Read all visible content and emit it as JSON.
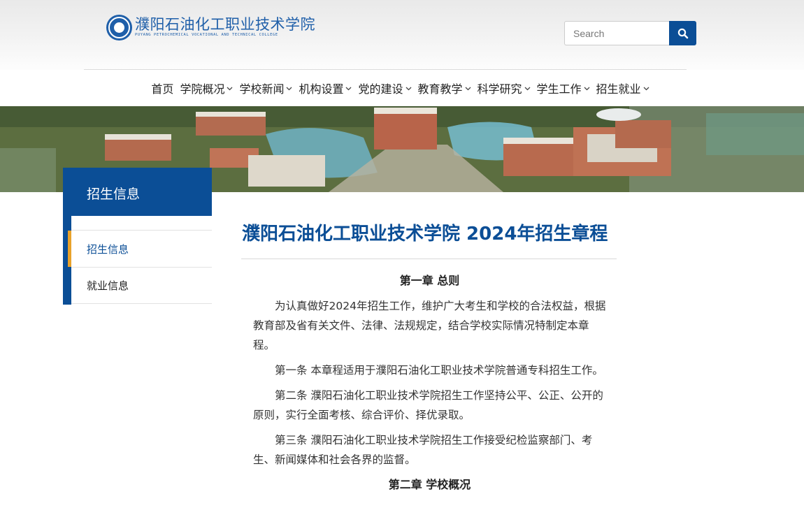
{
  "header": {
    "logo_cn": "濮阳石油化工职业技术学院",
    "logo_en": "PUYANG PETROCHEMICAL VOCATIONAL AND TECHNICAL COLLEGE",
    "search_placeholder": "Search",
    "search_icon": "search-icon",
    "brand_color": "#0b4e96"
  },
  "nav": {
    "items": [
      {
        "label": "首页",
        "has_dropdown": false
      },
      {
        "label": "学院概况",
        "has_dropdown": true
      },
      {
        "label": "学校新闻",
        "has_dropdown": true
      },
      {
        "label": "机构设置",
        "has_dropdown": true
      },
      {
        "label": "党的建设",
        "has_dropdown": true
      },
      {
        "label": "教育教学",
        "has_dropdown": true
      },
      {
        "label": "科学研究",
        "has_dropdown": true
      },
      {
        "label": "学生工作",
        "has_dropdown": true
      },
      {
        "label": "招生就业",
        "has_dropdown": true
      }
    ]
  },
  "sidebar": {
    "title": "招生信息",
    "items": [
      {
        "label": "招生信息",
        "active": true
      },
      {
        "label": "就业信息",
        "active": false
      }
    ],
    "accent_color": "#e8a22b"
  },
  "article": {
    "title": "濮阳石油化工职业技术学院 2024年招生章程",
    "chapter1": "第一章 总则",
    "paragraphs": [
      "为认真做好2024年招生工作，维护广大考生和学校的合法权益，根据教育部及省有关文件、法律、法规规定，结合学校实际情况特制定本章程。",
      "第一条 本章程适用于濮阳石油化工职业技术学院普通专科招生工作。",
      "第二条 濮阳石油化工职业技术学院招生工作坚持公平、公正、公开的原则，实行全面考核、综合评价、择优录取。",
      "第三条 濮阳石油化工职业技术学院招生工作接受纪检监察部门、考生、新闻媒体和社会各界的监督。"
    ],
    "chapter2": "第二章 学校概况"
  }
}
